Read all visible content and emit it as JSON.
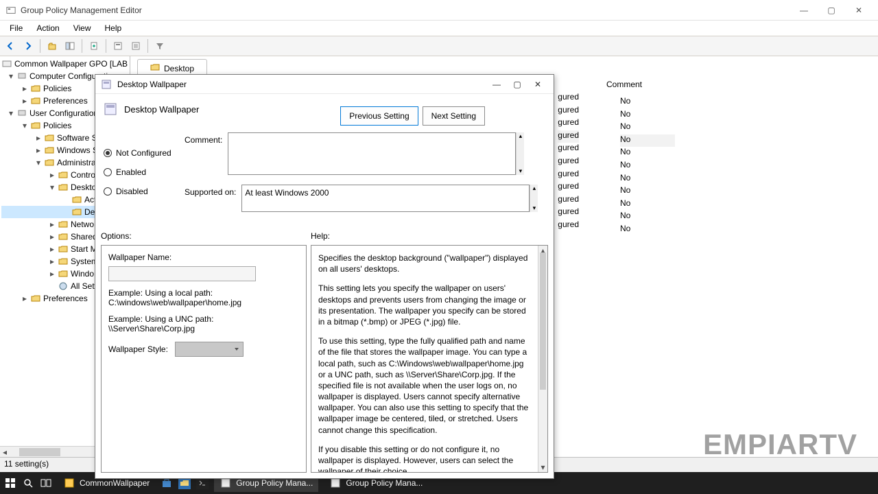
{
  "window": {
    "title": "Group Policy Management Editor",
    "min": "—",
    "max": "▢",
    "close": "✕"
  },
  "menu": {
    "file": "File",
    "action": "Action",
    "view": "View",
    "help": "Help"
  },
  "tree": {
    "root": "Common Wallpaper GPO [LAB",
    "comp_conf": "Computer Configuration",
    "policies1": "Policies",
    "prefs1": "Preferences",
    "user_conf": "User Configuration",
    "policies2": "Policies",
    "soft": "Software S",
    "wins": "Windows S",
    "admin": "Administrat",
    "control": "Contro",
    "desktop": "Deskto",
    "act": "Act",
    "des": "Des",
    "netw": "Netwo",
    "shared": "Shared",
    "startm": "Start M",
    "system": "System",
    "windo": "Windo",
    "allsett": "All Sett",
    "prefs2": "Preferences"
  },
  "content": {
    "tab": "Desktop",
    "header_comment": "Comment",
    "state_gured": "gured",
    "comment_no": "No"
  },
  "dialog": {
    "title": "Desktop Wallpaper",
    "heading": "Desktop Wallpaper",
    "prev": "Previous Setting",
    "next": "Next Setting",
    "not_configured": "Not Configured",
    "enabled": "Enabled",
    "disabled": "Disabled",
    "comment_label": "Comment:",
    "supported_label": "Supported on:",
    "supported_value": "At least Windows 2000",
    "options_label": "Options:",
    "help_label": "Help:",
    "wallpaper_name": "Wallpaper Name:",
    "example_local_l1": "Example: Using a local path:",
    "example_local_l2": "C:\\windows\\web\\wallpaper\\home.jpg",
    "example_unc_l1": "Example: Using a UNC path:",
    "example_unc_l2": "\\\\Server\\Share\\Corp.jpg",
    "wallpaper_style": "Wallpaper Style:",
    "help_p1": "Specifies the desktop background (\"wallpaper\") displayed on all users' desktops.",
    "help_p2": "This setting lets you specify the wallpaper on users' desktops and prevents users from changing the image or its presentation. The wallpaper you specify can be stored in a bitmap (*.bmp) or JPEG (*.jpg) file.",
    "help_p3": "To use this setting, type the fully qualified path and name of the file that stores the wallpaper image. You can type a local path, such as C:\\Windows\\web\\wallpaper\\home.jpg or a UNC path, such as \\\\Server\\Share\\Corp.jpg. If the specified file is not available when the user logs on, no wallpaper is displayed. Users cannot specify alternative wallpaper. You can also use this setting to specify that the wallpaper image be centered, tiled, or stretched. Users cannot change this specification.",
    "help_p4": "If you disable this setting or do not configure it, no wallpaper is displayed. However, users can select the wallpaper of their choice."
  },
  "status": "11 setting(s)",
  "taskbar": {
    "item1": "CommonWallpaper",
    "item2": "Group Policy Mana...",
    "item3": "Group Policy Mana..."
  },
  "watermark": "EMPIARTV"
}
